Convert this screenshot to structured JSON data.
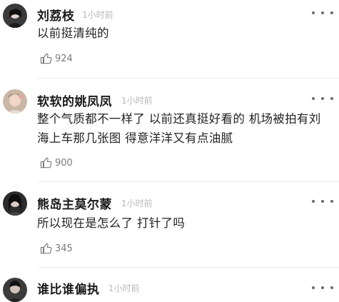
{
  "comments": [
    {
      "username": "刘荔枝",
      "time": "1小时前",
      "text": "以前挺清纯的",
      "likes": "924",
      "avatar_icon": "user-avatar-dark"
    },
    {
      "username": "软软的姚凤凤",
      "time": "1小时前",
      "text": "整个气质都不一样了 以前还真挺好看的 机场被拍有刘海上车那几张图 得意洋洋又有点油腻",
      "likes": "900",
      "avatar_icon": "user-avatar-light"
    },
    {
      "username": "熊岛主莫尔蒙",
      "time": "1小时前",
      "text": "所以现在是怎么了 打针了吗",
      "likes": "345",
      "avatar_icon": "user-avatar-dark"
    },
    {
      "username": "谁比谁偏执",
      "time": "1小时前",
      "avatar_icon": "user-avatar-dark"
    }
  ],
  "icons": {
    "more": "more-dots-icon",
    "like": "thumb-up-icon"
  }
}
